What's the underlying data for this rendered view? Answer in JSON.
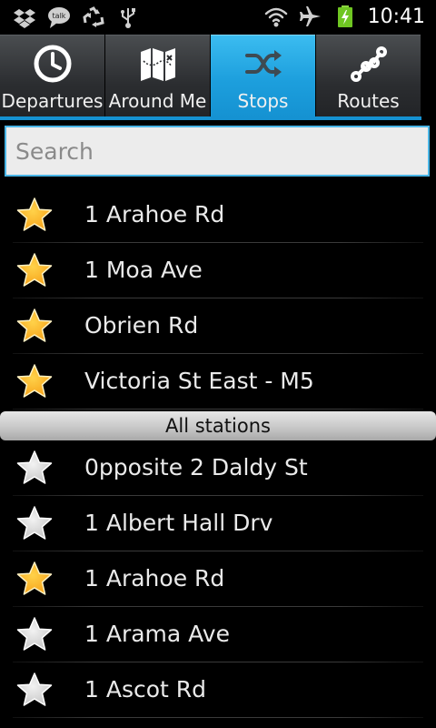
{
  "status_bar": {
    "time": "10:41",
    "left_icons": [
      "dropbox-icon",
      "talk-icon",
      "recycle-icon",
      "usb-icon"
    ],
    "right_icons": [
      "wifi-icon",
      "airplane-mode-icon",
      "battery-charging-icon"
    ]
  },
  "tabs": [
    {
      "label": "Departures",
      "icon": "clock-icon",
      "active": false
    },
    {
      "label": "Around Me",
      "icon": "map-icon",
      "active": false
    },
    {
      "label": "Stops",
      "icon": "shuffle-icon",
      "active": true
    },
    {
      "label": "Routes",
      "icon": "route-icon",
      "active": false
    }
  ],
  "search": {
    "placeholder": "Search",
    "value": ""
  },
  "favorites": [
    {
      "name": "1 Arahoe Rd",
      "starred": true
    },
    {
      "name": "1 Moa Ave",
      "starred": true
    },
    {
      "name": "Obrien Rd",
      "starred": true
    },
    {
      "name": "Victoria St East - M5",
      "starred": true
    }
  ],
  "section_header": "All stations",
  "stations": [
    {
      "name": "0pposite 2 Daldy St",
      "starred": false
    },
    {
      "name": "1 Albert Hall Drv",
      "starred": false
    },
    {
      "name": "1 Arahoe Rd",
      "starred": true
    },
    {
      "name": "1 Arama Ave",
      "starred": false
    },
    {
      "name": "1 Ascot Rd",
      "starred": false
    }
  ],
  "colors": {
    "accent": "#1d9fdd",
    "star_on": "#f7a51c",
    "star_off": "#c9c9c9"
  }
}
